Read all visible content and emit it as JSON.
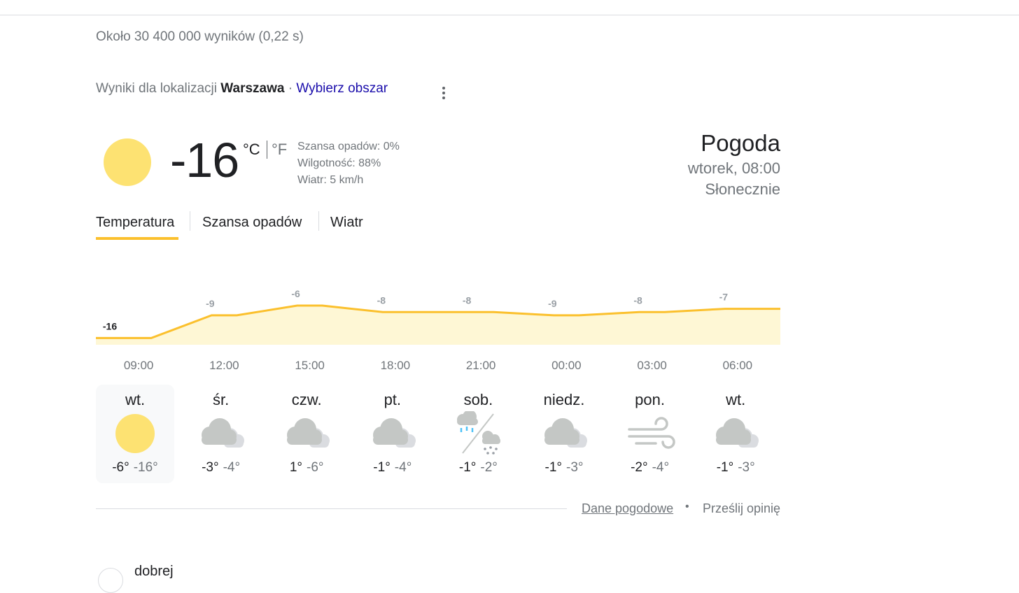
{
  "result_stats": "Około 30 400 000 wyników (0,22 s)",
  "location": {
    "prefix": "Wyniki dla lokalizacji",
    "city": "Warszawa",
    "separator": "·",
    "change_link": "Wybierz obszar"
  },
  "current": {
    "icon": "sun-icon",
    "temperature": "-16",
    "unit_c": "°C",
    "unit_f": "°F",
    "precip": "Szansa opadów: 0%",
    "humidity": "Wilgotność: 88%",
    "wind": "Wiatr: 5 km/h"
  },
  "header": {
    "title": "Pogoda",
    "datetime": "wtorek, 08:00",
    "condition": "Słonecznie"
  },
  "tabs": [
    {
      "label": "Temperatura",
      "active": true
    },
    {
      "label": "Szansa opadów",
      "active": false
    },
    {
      "label": "Wiatr",
      "active": false
    }
  ],
  "chart_data": {
    "type": "area",
    "x": [
      "09:00",
      "12:00",
      "15:00",
      "18:00",
      "21:00",
      "00:00",
      "03:00",
      "06:00"
    ],
    "series": [
      {
        "values": [
          -16,
          -9,
          -6,
          -8,
          -8,
          -9,
          -8,
          -7
        ]
      }
    ],
    "data_labels": [
      "-16",
      "-9",
      "-6",
      "-8",
      "-8",
      "-9",
      "-8",
      "-7"
    ],
    "line_color": "#fbc02d",
    "fill_color": "#fef7d5",
    "grid": false
  },
  "days": [
    {
      "name": "wt.",
      "icon": "sun-icon",
      "high": "-6°",
      "low": "-16°",
      "selected": true
    },
    {
      "name": "śr.",
      "icon": "cloudy-icon",
      "high": "-3°",
      "low": "-4°",
      "selected": false
    },
    {
      "name": "czw.",
      "icon": "cloudy-icon",
      "high": "1°",
      "low": "-6°",
      "selected": false
    },
    {
      "name": "pt.",
      "icon": "cloudy-icon",
      "high": "-1°",
      "low": "-4°",
      "selected": false
    },
    {
      "name": "sob.",
      "icon": "rain-snow-icon",
      "high": "-1°",
      "low": "-2°",
      "selected": false
    },
    {
      "name": "niedz.",
      "icon": "cloudy-icon",
      "high": "-1°",
      "low": "-3°",
      "selected": false
    },
    {
      "name": "pon.",
      "icon": "wind-icon",
      "high": "-2°",
      "low": "-4°",
      "selected": false
    },
    {
      "name": "wt.",
      "icon": "cloudy-icon",
      "high": "-1°",
      "low": "-3°",
      "selected": false
    }
  ],
  "footer": {
    "data_link": "Dane pogodowe",
    "dot": "•",
    "feedback_link": "Prześlij opinię"
  },
  "next_result": {
    "text": "dobrej"
  }
}
